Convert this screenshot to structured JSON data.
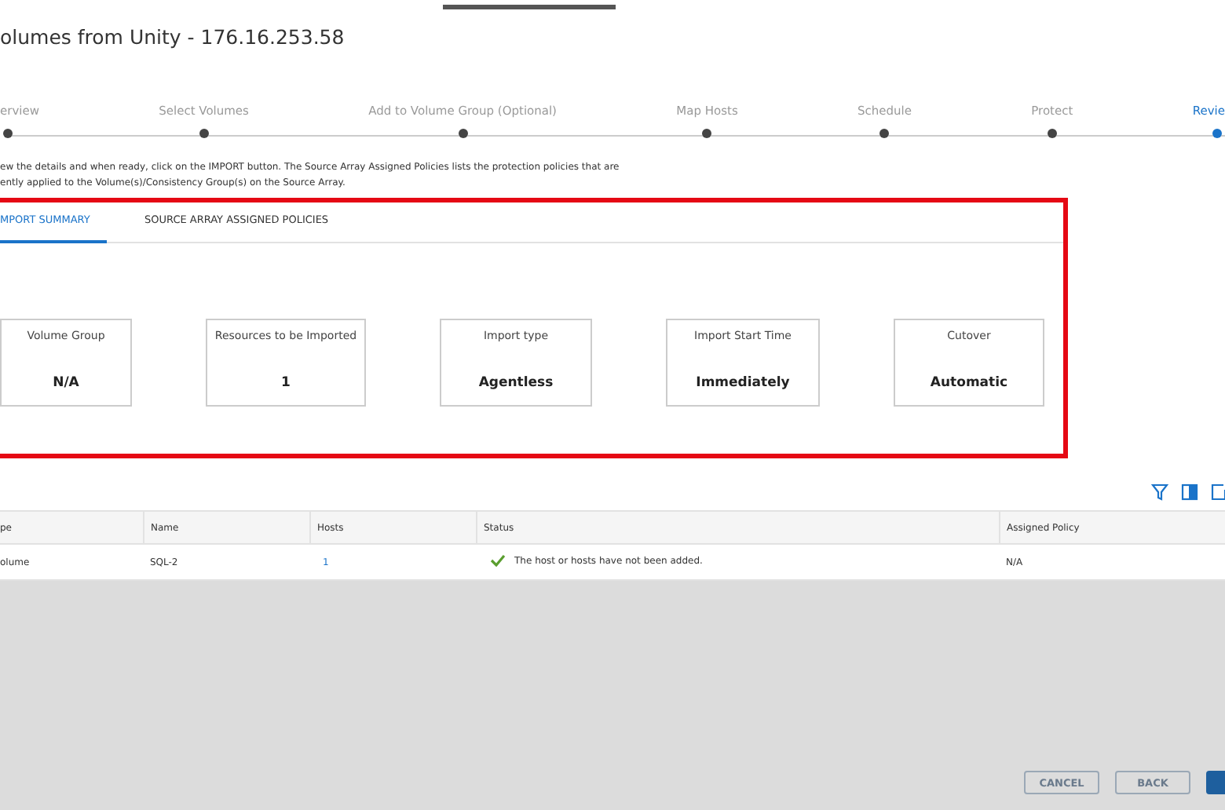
{
  "window": {
    "title": "olumes from Unity - 176.16.253.58"
  },
  "steps": [
    {
      "label": "erview",
      "selected": false
    },
    {
      "label": "Select Volumes",
      "selected": false
    },
    {
      "label": "Add to Volume Group (Optional)",
      "selected": false
    },
    {
      "label": "Map Hosts",
      "selected": false
    },
    {
      "label": "Schedule",
      "selected": false
    },
    {
      "label": "Protect",
      "selected": false
    },
    {
      "label": "Revie",
      "selected": true
    }
  ],
  "description": [
    "ew the details and when ready, click on the IMPORT button. The Source Array Assigned Policies lists the protection policies that are",
    "ently applied to the Volume(s)/Consistency Group(s) on the Source Array."
  ],
  "tabs": [
    {
      "label": "MPORT SUMMARY",
      "selected": true
    },
    {
      "label": "SOURCE ARRAY ASSIGNED POLICIES",
      "selected": false
    }
  ],
  "summary_cards": [
    {
      "label": "Volume Group",
      "value": "N/A"
    },
    {
      "label": "Resources to be Imported",
      "value": "1"
    },
    {
      "label": "Import type",
      "value": "Agentless"
    },
    {
      "label": "Import Start Time",
      "value": "Immediately"
    },
    {
      "label": "Cutover",
      "value": "Automatic"
    }
  ],
  "table": {
    "columns": [
      "pe",
      "Name",
      "Hosts",
      "Status",
      "Assigned Policy"
    ],
    "rows": [
      {
        "type": "olume",
        "name": "SQL-2",
        "hosts": "1",
        "status": "The host or hosts have not been added.",
        "status_ok": true,
        "policy": "N/A"
      }
    ]
  },
  "buttons": [
    {
      "label": "CANCEL",
      "kind": "secondary"
    },
    {
      "label": "BACK",
      "kind": "secondary"
    },
    {
      "kind": "primary"
    }
  ]
}
